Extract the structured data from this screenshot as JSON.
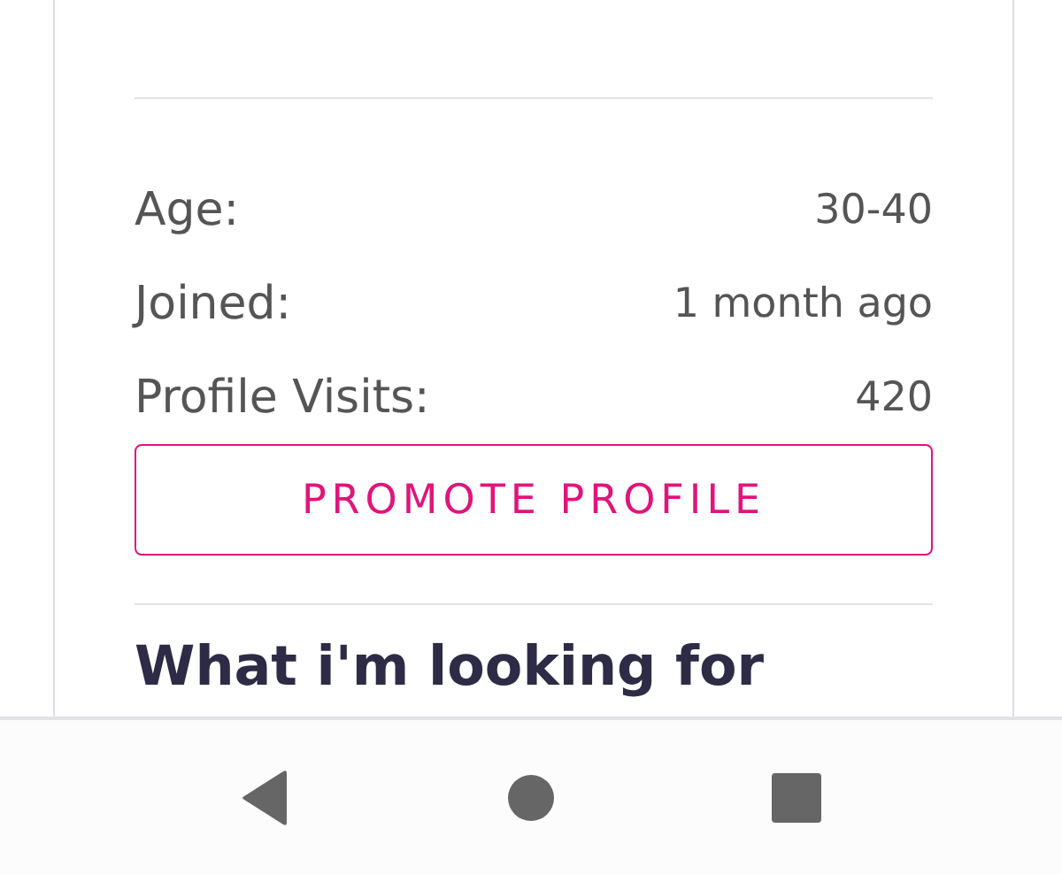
{
  "stats": [
    {
      "label": "Age:",
      "value": "30-40"
    },
    {
      "label": "Joined:",
      "value": "1 month ago"
    },
    {
      "label": "Profile Visits:",
      "value": "420"
    }
  ],
  "promote_button": "PROMOTE PROFILE",
  "section_heading": "What i'm looking for"
}
